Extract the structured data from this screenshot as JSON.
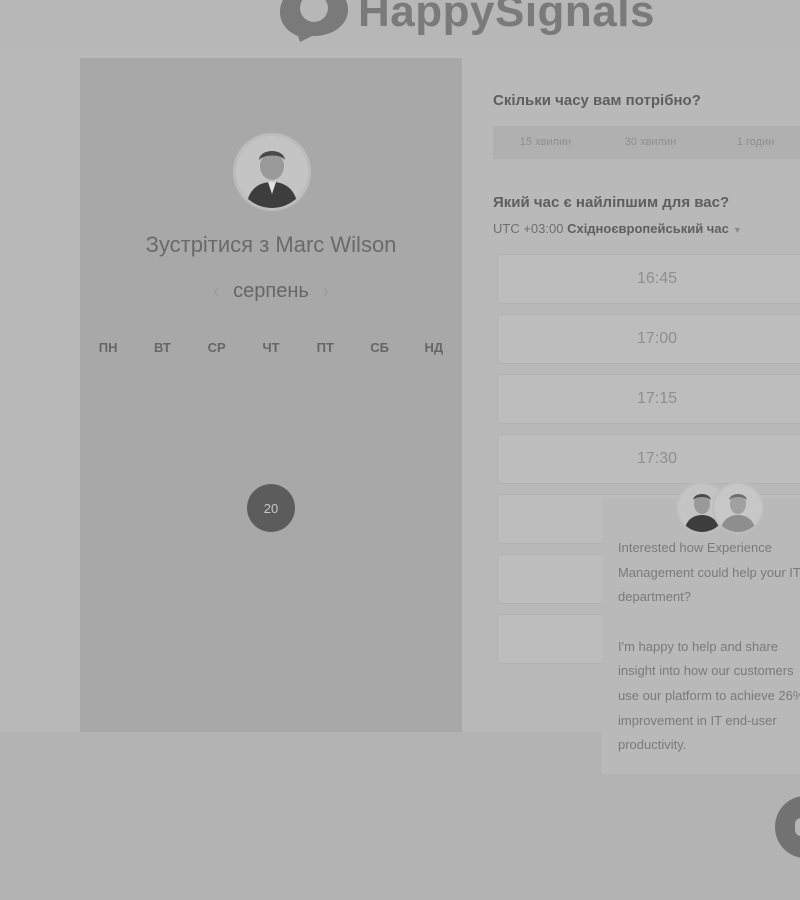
{
  "brand": {
    "name": "HappySignals"
  },
  "profile": {
    "title": "Зустрітися з Marc Wilson"
  },
  "calendar": {
    "month": "серпень",
    "weekdays": [
      "ПН",
      "ВТ",
      "СР",
      "ЧТ",
      "ПТ",
      "СБ",
      "НД"
    ],
    "days": [
      "",
      "",
      "",
      "",
      "",
      "",
      "",
      "",
      "",
      "",
      "",
      "",
      "",
      "",
      "",
      "",
      "",
      "",
      "",
      "",
      "",
      "",
      "",
      "",
      "",
      "",
      "",
      "",
      "",
      "",
      "",
      "",
      "",
      "",
      ""
    ],
    "selected_day": "20"
  },
  "duration": {
    "question": "Скільки часу вам потрібно?",
    "options": [
      "15 хвилин",
      "30 хвилин",
      "1 годин"
    ]
  },
  "time": {
    "question": "Який час є найліпшим для вас?",
    "tz_prefix": "UTC +03:00",
    "tz_name": "Східноєвропейський час",
    "slots": [
      "16:45",
      "17:00",
      "17:15",
      "17:30",
      "",
      "",
      ""
    ]
  },
  "chat": {
    "message_1": "Interested how Experience Management could help your IT department?",
    "message_2": "I'm happy to help and share insight into how our customers use our platform to achieve 26% improvement in IT end-user productivity."
  },
  "colors": {
    "selected_day": "#5c5c5c",
    "panel": "#a8a8a8"
  }
}
